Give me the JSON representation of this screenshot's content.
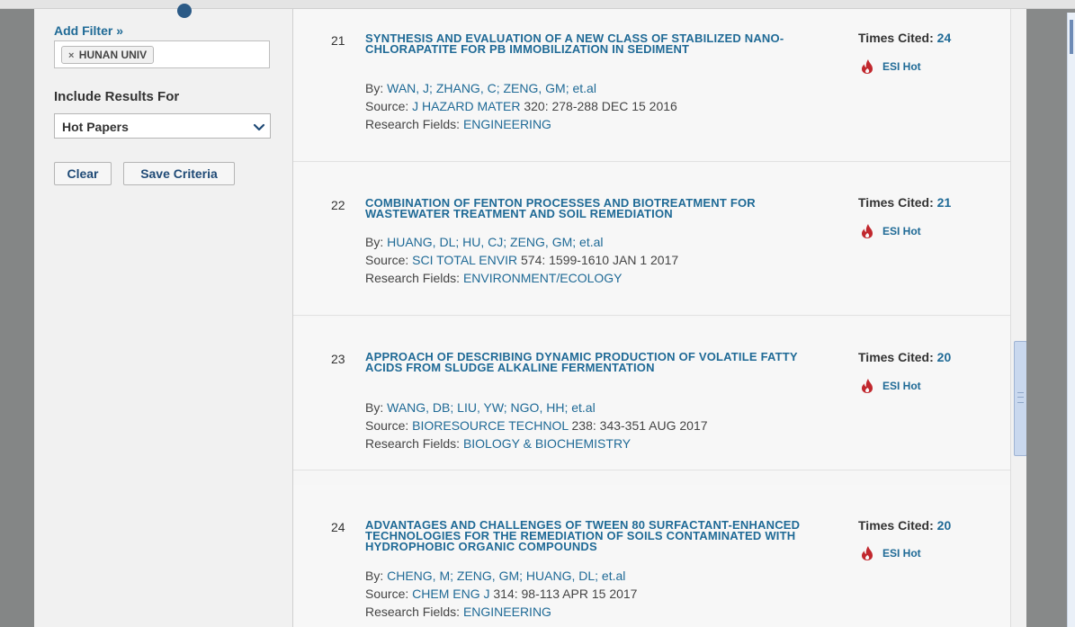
{
  "sidebar": {
    "add_filter": "Add Filter »",
    "filter_tag": "HUNAN UNIV",
    "filter_tag_remove": "×",
    "include_label": "Include Results For",
    "include_select": "Hot Papers",
    "clear_label": "Clear",
    "save_label": "Save Criteria"
  },
  "records": [
    {
      "num": "21",
      "title": "SYNTHESIS AND EVALUATION OF A NEW CLASS OF STABILIZED NANO-CHLORAPATITE FOR PB IMMOBILIZATION IN SEDIMENT",
      "by_label": "By:",
      "authors": "WAN, J;  ZHANG, C;  ZENG, GM;  et.al",
      "source_label": "Source:",
      "source_journal": "J HAZARD MATER",
      "source_detail": "320: 278-288 DEC 15 2016",
      "fields_label": "Research Fields:",
      "field": "ENGINEERING",
      "cited_label": "Times Cited:",
      "cited": "24",
      "hot_label": "ESI Hot"
    },
    {
      "num": "22",
      "title": "COMBINATION OF FENTON PROCESSES AND BIOTREATMENT FOR WASTEWATER TREATMENT AND SOIL REMEDIATION",
      "by_label": "By:",
      "authors": "HUANG, DL;  HU, CJ;  ZENG, GM;  et.al",
      "source_label": "Source:",
      "source_journal": "SCI TOTAL ENVIR",
      "source_detail": "574: 1599-1610 JAN 1 2017",
      "fields_label": "Research Fields:",
      "field": "ENVIRONMENT/ECOLOGY",
      "cited_label": "Times Cited:",
      "cited": "21",
      "hot_label": "ESI Hot"
    },
    {
      "num": "23",
      "title": "APPROACH OF DESCRIBING DYNAMIC PRODUCTION OF VOLATILE FATTY ACIDS FROM SLUDGE ALKALINE FERMENTATION",
      "by_label": "By:",
      "authors": "WANG, DB;  LIU, YW;  NGO, HH;  et.al",
      "source_label": "Source:",
      "source_journal": "BIORESOURCE TECHNOL",
      "source_detail": "238: 343-351 AUG 2017",
      "fields_label": "Research Fields:",
      "field": "BIOLOGY & BIOCHEMISTRY",
      "cited_label": "Times Cited:",
      "cited": "20",
      "hot_label": "ESI Hot"
    },
    {
      "num": "24",
      "title": "ADVANTAGES AND CHALLENGES OF TWEEN 80 SURFACTANT-ENHANCED TECHNOLOGIES FOR THE REMEDIATION OF SOILS CONTAMINATED WITH HYDROPHOBIC ORGANIC COMPOUNDS",
      "by_label": "By:",
      "authors": "CHENG, M;  ZENG, GM;  HUANG, DL;  et.al",
      "source_label": "Source:",
      "source_journal": "CHEM ENG J",
      "source_detail": "314: 98-113 APR 15 2017",
      "fields_label": "Research Fields:",
      "field": "ENGINEERING",
      "cited_label": "Times Cited:",
      "cited": "20",
      "hot_label": "ESI Hot"
    }
  ],
  "colors": {
    "link": "#1f6a96",
    "flame": "#c1272d"
  },
  "icons": {
    "hot": "flame-icon",
    "select": "chevron-down-icon"
  }
}
